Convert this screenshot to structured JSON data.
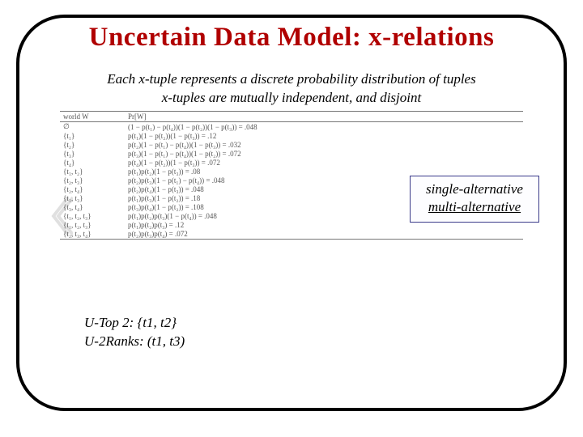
{
  "title": "Uncertain Data Model: x-relations",
  "subtitle_line1": "Each x-tuple represents a discrete probability distribution of tuples",
  "subtitle_line2": "x-tuples are mutually independent, and disjoint",
  "table": {
    "headers": [
      "world W",
      "Pr[W]"
    ],
    "rows": [
      {
        "w": "∅",
        "pr": "(1 − p(t₁) − p(t₄))(1 − p(t₂))(1 − p(t₃)) = .048"
      },
      {
        "w": "{t₁}",
        "pr": "p(t₁)(1 − p(t₂))(1 − p(t₃)) = .12"
      },
      {
        "w": "{t₂}",
        "pr": "p(t₂)(1 − p(t₁) − p(t₄))(1 − p(t₃)) = .032"
      },
      {
        "w": "{t₃}",
        "pr": "p(t₃)(1 − p(t₁) − p(t₄))(1 − p(t₂)) = .072"
      },
      {
        "w": "{t₄}",
        "pr": "p(t₄)(1 − p(t₂))(1 − p(t₃)) = .072"
      },
      {
        "w": "{t₁, t₂}",
        "pr": "p(t₁)p(t₂)(1 − p(t₃)) = .08"
      },
      {
        "w": "{t₂, t₃}",
        "pr": "p(t₂)p(t₃)(1 − p(t₁) − p(t₄)) = .048"
      },
      {
        "w": "{t₂, t₄}",
        "pr": "p(t₂)p(t₄)(1 − p(t₃)) = .048"
      },
      {
        "w": "{t₁, t₃}",
        "pr": "p(t₁)p(t₃)(1 − p(t₂)) = .18"
      },
      {
        "w": "{t₃, t₄}",
        "pr": "p(t₃)p(t₄)(1 − p(t₂)) = .108"
      },
      {
        "w": "{t₁, t₂, t₃}",
        "pr": "p(t₁)p(t₂)p(t₃)(1 − p(t₄)) = .048"
      },
      {
        "w": "{t₁, t₂, t₃}",
        "pr": "p(t₁)p(t₂)p(t₃) = .12"
      },
      {
        "w": "{t₂, t₃, t₄}",
        "pr": "p(t₂)p(t₃)p(t₄) = .072"
      }
    ]
  },
  "legend": {
    "line1": "single-alternative",
    "line2": "multi-alternative"
  },
  "bottom": {
    "line1": "U-Top 2: {t1, t2}",
    "line2": "U-2Ranks: (t1, t3)"
  }
}
